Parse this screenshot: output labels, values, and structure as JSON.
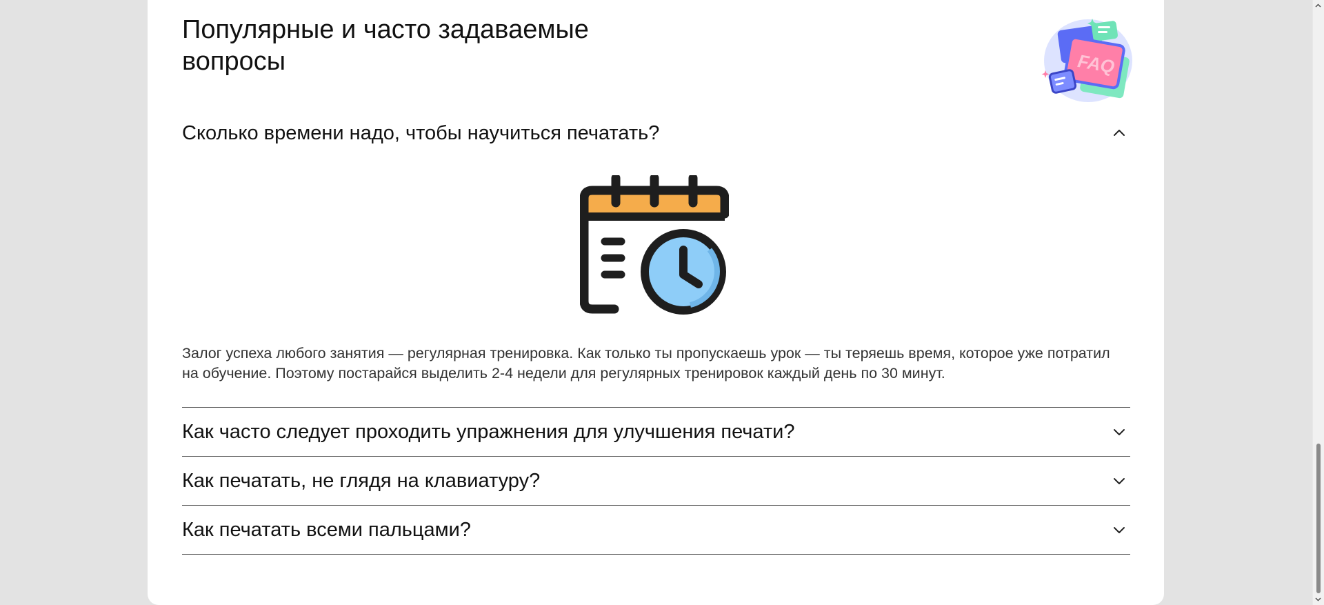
{
  "faq": {
    "title": "Популярные и часто задаваемые вопросы",
    "badge_icon": "faq-chat-bubbles-icon",
    "items": [
      {
        "question": "Сколько времени надо, чтобы научиться печатать?",
        "expanded": true,
        "illustration_icon": "calendar-clock-icon",
        "answer": "Залог успеха любого занятия — регулярная тренировка. Как только ты пропускаешь урок — ты теряешь время, которое уже потратил на обучение. Поэтому постарайся выделить 2-4 недели для регулярных тренировок каждый день по 30 минут."
      },
      {
        "question": "Как часто следует проходить упражнения для улучшения печати?",
        "expanded": false
      },
      {
        "question": "Как печатать, не глядя на клавиатуру?",
        "expanded": false
      },
      {
        "question": "Как печатать всеми пальцами?",
        "expanded": false
      }
    ]
  },
  "colors": {
    "background": "#e3e3e3",
    "card": "#ffffff",
    "text": "#111111",
    "calendar_accent": "#f5ac4b",
    "clock_face": "#8ecdf8",
    "divider": "#555555"
  },
  "badge_text": "FAQ"
}
